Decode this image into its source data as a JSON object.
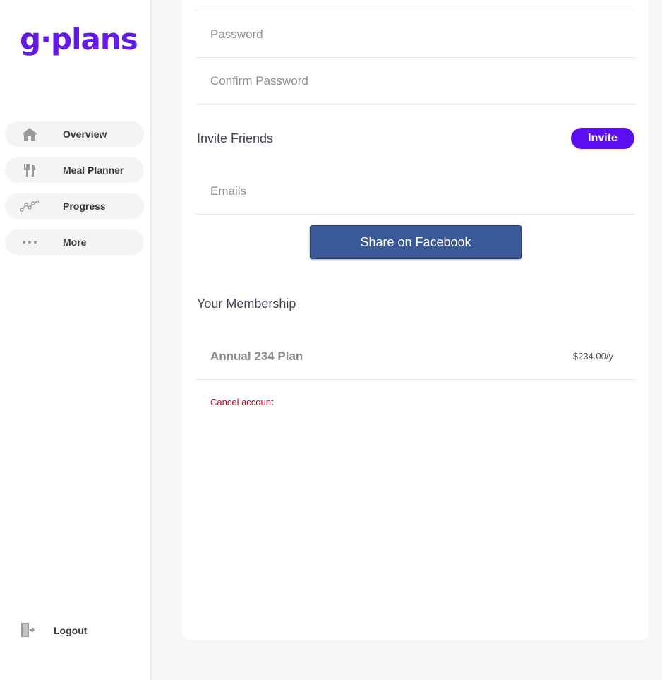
{
  "brand": {
    "logo": "g·plans",
    "color": "#6419e6"
  },
  "sidebar": {
    "items": [
      {
        "label": "Overview",
        "icon": "home-icon"
      },
      {
        "label": "Meal Planner",
        "icon": "utensils-icon"
      },
      {
        "label": "Progress",
        "icon": "progress-chart-icon"
      },
      {
        "label": "More",
        "icon": "more-dots-icon"
      }
    ],
    "logout": {
      "label": "Logout",
      "icon": "logout-icon"
    }
  },
  "account": {
    "password_placeholder": "Password",
    "confirm_password_placeholder": "Confirm Password"
  },
  "invite": {
    "title": "Invite Friends",
    "button": "Invite",
    "emails_placeholder": "Emails",
    "facebook_button": "Share on Facebook"
  },
  "membership": {
    "title": "Your Membership",
    "plan_name": "Annual 234 Plan",
    "plan_price": "$234.00/y",
    "cancel_label": "Cancel account"
  },
  "colors": {
    "accent": "#5b0ff2",
    "facebook": "#3b5998",
    "danger": "#d0021b"
  }
}
